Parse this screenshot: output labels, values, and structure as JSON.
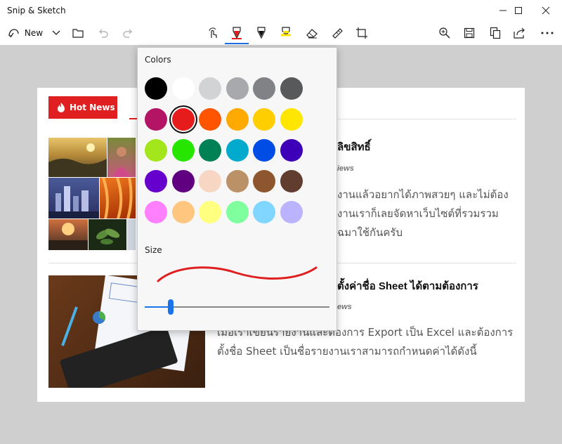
{
  "window": {
    "title": "Snip & Sketch",
    "controls": [
      "minimize-icon",
      "maximize-icon",
      "close-icon"
    ]
  },
  "toolbar": {
    "new_label": "New",
    "left_icons": [
      "new-snip-icon",
      "chevron-down-icon",
      "folder-icon",
      "undo-icon",
      "redo-icon"
    ],
    "center_tools": [
      "touch-writing-icon",
      "ballpoint-pen-icon",
      "pencil-icon",
      "highlighter-icon",
      "eraser-icon",
      "ruler-icon",
      "crop-icon"
    ],
    "right_icons": [
      "zoom-icon",
      "save-icon",
      "copy-icon",
      "share-icon",
      "more-icon"
    ],
    "accent_color": "#1a73e8"
  },
  "popup": {
    "colors_label": "Colors",
    "size_label": "Size",
    "swatches": [
      "#000000",
      "#ffffff",
      "#d1d3d4",
      "#a7a9ac",
      "#808285",
      "#58595b",
      "#b31564",
      "#e61b1b",
      "#ff5500",
      "#ffaa00",
      "#ffce00",
      "#ffe600",
      "#a2e61b",
      "#26e600",
      "#008055",
      "#00aacc",
      "#004de6",
      "#3d00b8",
      "#6600cc",
      "#600080",
      "#f7d7c4",
      "#bb9167",
      "#8e562e",
      "#613d30",
      "#ff80ff",
      "#ffc680",
      "#ffff80",
      "#80ff9e",
      "#80d6ff",
      "#bcb3ff"
    ],
    "selected_color": "#e61b1b",
    "stroke_color": "#e02020",
    "size_level": 0.14
  },
  "content": {
    "hot_news_label": "Hot News",
    "hot_news_color": "#e02020",
    "articles": [
      {
        "title": "ลิขสิทธิ์",
        "meta": "iews",
        "body_lines": [
          "งานแล้วอยากได้ภาพสวยๆ และไม่ต้อง",
          "งานเราก็เลยจัดหาเว็บไซต์ที่รวมรวม",
          "ฉมาใช้กันครับ"
        ]
      },
      {
        "title": "ตั้งค่าชื่อ Sheet ได้ตามต้องการ",
        "meta": "ews",
        "body_lines": [
          "เมื่อเราเขียนรายงานและต้องการ Export เป็น Excel และต้องการ",
          "ตั้งชื่อ Sheet เป็นชื่อรายงานเราสามารถกำหนดค่าได้ดังนี้"
        ]
      }
    ]
  }
}
